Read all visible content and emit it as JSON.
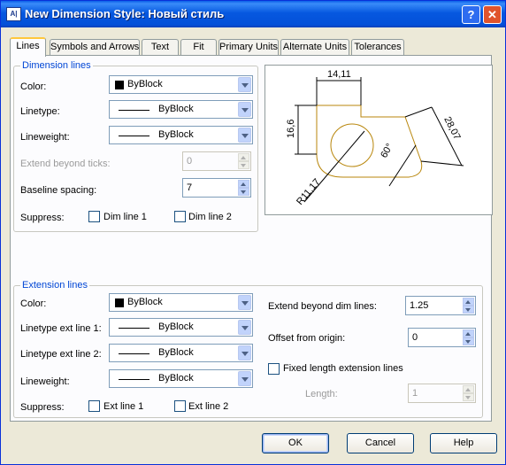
{
  "window": {
    "title": "New Dimension Style: Новый стиль",
    "icon": "autocad-dialog-icon"
  },
  "title_buttons": {
    "help": "?",
    "close": "✕"
  },
  "tabs": [
    "Lines",
    "Symbols and Arrows",
    "Text",
    "Fit",
    "Primary Units",
    "Alternate Units",
    "Tolerances"
  ],
  "active_tab": "Lines",
  "dim_lines": {
    "group_title": "Dimension lines",
    "color_label": "Color:",
    "color_value": "ByBlock",
    "linetype_label": "Linetype:",
    "linetype_value": "ByBlock",
    "lineweight_label": "Lineweight:",
    "lineweight_value": "ByBlock",
    "extend_label": "Extend beyond ticks:",
    "extend_value": "0",
    "baseline_label": "Baseline spacing:",
    "baseline_value": "7",
    "suppress_label": "Suppress:",
    "dim1_label": "Dim line 1",
    "dim2_label": "Dim line 2"
  },
  "preview": {
    "dim_top": "14,11",
    "dim_left": "16,6",
    "dim_right": "28,07",
    "angle": "60°",
    "radius": "R11,17"
  },
  "ext_lines": {
    "group_title": "Extension lines",
    "color_label": "Color:",
    "color_value": "ByBlock",
    "lt1_label": "Linetype ext line 1:",
    "lt1_value": "ByBlock",
    "lt2_label": "Linetype ext line 2:",
    "lt2_value": "ByBlock",
    "lw_label": "Lineweight:",
    "lw_value": "ByBlock",
    "suppress_label": "Suppress:",
    "ext1_label": "Ext line 1",
    "ext2_label": "Ext line 2",
    "extend_label": "Extend beyond dim lines:",
    "extend_value": "1.25",
    "offset_label": "Offset from origin:",
    "offset_value": "0",
    "fixed_label": "Fixed length extension lines",
    "length_label": "Length:",
    "length_value": "1"
  },
  "buttons": {
    "ok": "OK",
    "cancel": "Cancel",
    "help": "Help"
  },
  "colors": {
    "title_bar": "#0658e0",
    "group_title": "#0046d5",
    "preview_geometry": "#b8860b"
  }
}
